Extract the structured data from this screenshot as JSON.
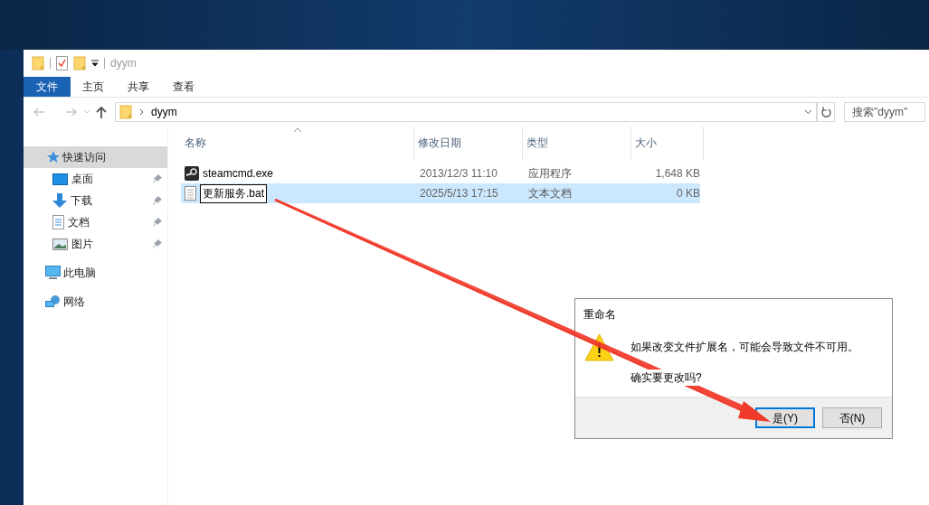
{
  "window": {
    "title": "dyym"
  },
  "ribbon_tabs": [
    {
      "label": "文件",
      "kind": "file"
    },
    {
      "label": "主页",
      "kind": "tab"
    },
    {
      "label": "共享",
      "kind": "tab"
    },
    {
      "label": "查看",
      "kind": "tab"
    }
  ],
  "address_bar": {
    "path": "dyym",
    "search_placeholder": "搜索\"dyym\""
  },
  "sidebar": {
    "items": [
      {
        "label": "快速访问",
        "kind": "star",
        "selected": true,
        "children": [
          {
            "label": "桌面",
            "kind": "desktop",
            "pinned": true
          },
          {
            "label": "下载",
            "kind": "download",
            "pinned": true
          },
          {
            "label": "文档",
            "kind": "document",
            "pinned": true
          },
          {
            "label": "图片",
            "kind": "picture",
            "pinned": true
          }
        ]
      },
      {
        "label": "此电脑",
        "kind": "computer",
        "selected": false
      },
      {
        "label": "网络",
        "kind": "network",
        "selected": false
      }
    ]
  },
  "table": {
    "columns": [
      {
        "label": "名称",
        "sorted": true
      },
      {
        "label": "修改日期",
        "sorted": false
      },
      {
        "label": "类型",
        "sorted": false
      },
      {
        "label": "大小",
        "sorted": false
      }
    ],
    "rows": [
      {
        "name": "steamcmd.exe",
        "kind": "exe",
        "modified": "2013/12/3 11:10",
        "type": "应用程序",
        "size": "1,648 KB",
        "selected": false,
        "renaming": false
      },
      {
        "name": "更新服务.bat",
        "kind": "text",
        "modified": "2025/5/13 17:15",
        "type": "文本文档",
        "size": "0 KB",
        "selected": true,
        "renaming": true
      }
    ]
  },
  "dialog": {
    "title": "重命名",
    "message": "如果改变文件扩展名，可能会导致文件不可用。",
    "question": "确实要更改吗?",
    "buttons": [
      {
        "label": "是(Y)",
        "default": true
      },
      {
        "label": "否(N)",
        "default": false
      }
    ]
  }
}
